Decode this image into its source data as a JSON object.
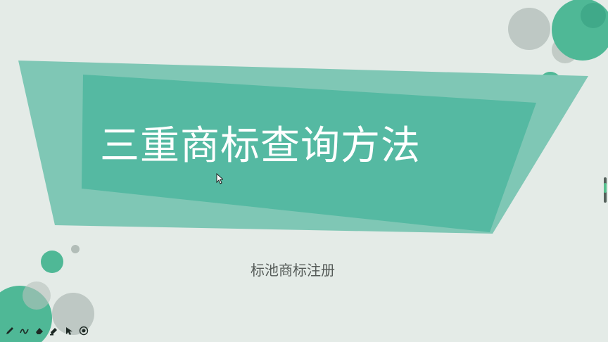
{
  "slide": {
    "title": "三重商标查询方法",
    "subtitle": "标池商标注册"
  },
  "toolbar": {
    "tools": [
      "pen-icon",
      "ink-icon",
      "eraser-icon",
      "highlighter-icon",
      "pointer-icon",
      "record-icon"
    ]
  },
  "colors": {
    "background": "#e4ebe7",
    "accent_light": "#7fc7b5",
    "accent_main": "#55b9a2",
    "circle_green": "#4db897",
    "circle_gray": "#b7c2bd",
    "subtitle_text": "#555b58"
  }
}
